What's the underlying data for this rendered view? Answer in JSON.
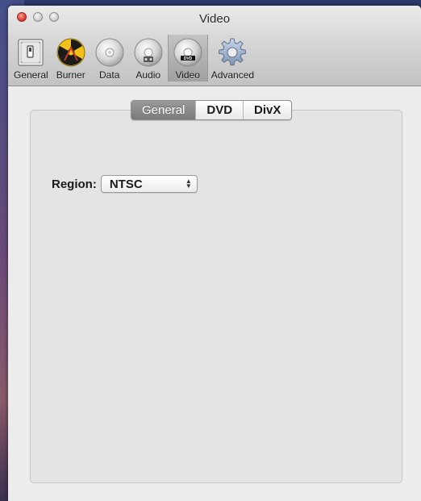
{
  "window": {
    "title": "Video"
  },
  "toolbar": {
    "items": [
      {
        "label": "General",
        "icon": "switch-icon"
      },
      {
        "label": "Burner",
        "icon": "burner-radiation-icon"
      },
      {
        "label": "Data",
        "icon": "data-disc-icon"
      },
      {
        "label": "Audio",
        "icon": "audio-disc-icon"
      },
      {
        "label": "Video",
        "icon": "dvd-disc-icon",
        "selected": true
      },
      {
        "label": "Advanced",
        "icon": "gear-icon"
      }
    ]
  },
  "tabs": [
    {
      "label": "General",
      "active": true
    },
    {
      "label": "DVD",
      "active": false
    },
    {
      "label": "DivX",
      "active": false
    }
  ],
  "region": {
    "label": "Region:",
    "value": "NTSC"
  },
  "colors": {
    "close": "#e0443a",
    "selected_tab": "#8a8a8a",
    "panel": "#e4e4e4"
  }
}
